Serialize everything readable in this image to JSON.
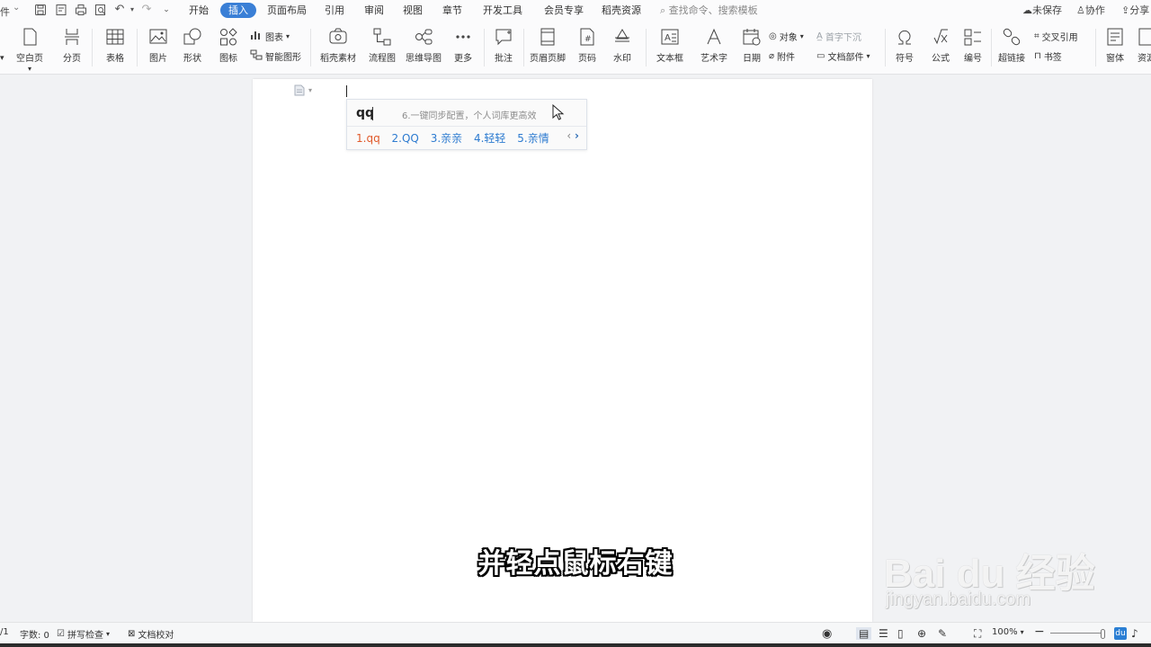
{
  "titlebar": {
    "doc_label": "件",
    "tabs": [
      "开始",
      "插入",
      "页面布局",
      "引用",
      "审阅",
      "视图",
      "章节",
      "开发工具",
      "会员专享",
      "稻壳资源"
    ],
    "active_tab": "插入",
    "search_placeholder": "查找命令、搜索模板",
    "unsaved": "未保存",
    "collab": "协作",
    "share": "分享"
  },
  "ribbon": {
    "blank_page": "空白页",
    "page_break": "分页",
    "table": "表格",
    "picture": "图片",
    "shape": "形状",
    "icon": "图标",
    "chart": "图表",
    "smart_art": "智能图形",
    "docer_material": "稻壳素材",
    "flowchart": "流程图",
    "mind_map": "思维导图",
    "more": "更多",
    "comment": "批注",
    "header_footer": "页眉页脚",
    "page_number": "页码",
    "watermark": "水印",
    "text_box": "文本框",
    "word_art": "艺术字",
    "date": "日期",
    "object": "对象",
    "attachment": "附件",
    "drop_cap": "首字下沉",
    "doc_parts": "文档部件",
    "symbol": "符号",
    "formula": "公式",
    "numbering": "编号",
    "hyperlink": "超链接",
    "cross_ref": "交叉引用",
    "bookmark": "书签",
    "form": "窗体",
    "resource": "资源"
  },
  "ime": {
    "composition": "qq",
    "hint": "6.一键同步配置，个人词库更高效",
    "candidates": [
      "1.qq",
      "2.QQ",
      "3.亲亲",
      "4.轻轻",
      "5.亲情"
    ],
    "prev": "‹",
    "next": "›"
  },
  "subtitle": "并轻点鼠标右键",
  "watermark": {
    "logo": "Bai du 经验",
    "site": "jingyan.baidu.com"
  },
  "statusbar": {
    "page": "/1",
    "word_count": "字数: 0",
    "spell_check": "拼写检查",
    "doc_proof": "文档校对",
    "zoom": "100%",
    "ime_badge": "du"
  },
  "colors": {
    "active_tab": "#3a7fd6",
    "candidate_first": "#e0592a",
    "candidate": "#2d7bd0",
    "ime_badge": "#2b7fd4"
  }
}
